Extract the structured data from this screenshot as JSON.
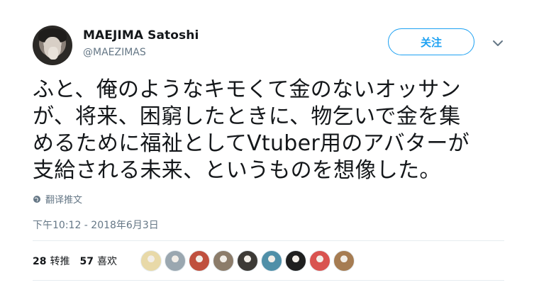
{
  "user": {
    "name": "MAEJIMA Satoshi",
    "handle": "@MAEZIMAS"
  },
  "follow_button": "关注",
  "tweet": {
    "lines": [
      "ふと、俺のようなキモくて金のないオッサン",
      "が、将来、困窮したときに、物乞いで金を集",
      "めるために福祉としてVtuber用のアバターが",
      "支給される未来、というものを想像した。"
    ],
    "translate_label": "翻译推文",
    "timestamp": "下午10:12 - 2018年6月3日"
  },
  "stats": {
    "retweets_count": "28",
    "retweets_label": "转推",
    "likes_count": "57",
    "likes_label": "喜欢"
  },
  "colors": {
    "accent": "#1da1f2",
    "muted": "#657786",
    "text": "#14171a",
    "divider": "#e6ecf0"
  },
  "liker_avatars": [
    {
      "icon": "liker-avatar-1",
      "color": "#e8d9a8"
    },
    {
      "icon": "liker-avatar-2",
      "color": "#9aa7b0"
    },
    {
      "icon": "liker-avatar-3",
      "color": "#c0503e"
    },
    {
      "icon": "liker-avatar-4",
      "color": "#8c7c6a"
    },
    {
      "icon": "liker-avatar-5",
      "color": "#3d3a36"
    },
    {
      "icon": "liker-avatar-6",
      "color": "#4f8fa8"
    },
    {
      "icon": "liker-avatar-7",
      "color": "#1f1f1f"
    },
    {
      "icon": "liker-avatar-8",
      "color": "#d9534f"
    },
    {
      "icon": "liker-avatar-9",
      "color": "#a67c52"
    }
  ]
}
